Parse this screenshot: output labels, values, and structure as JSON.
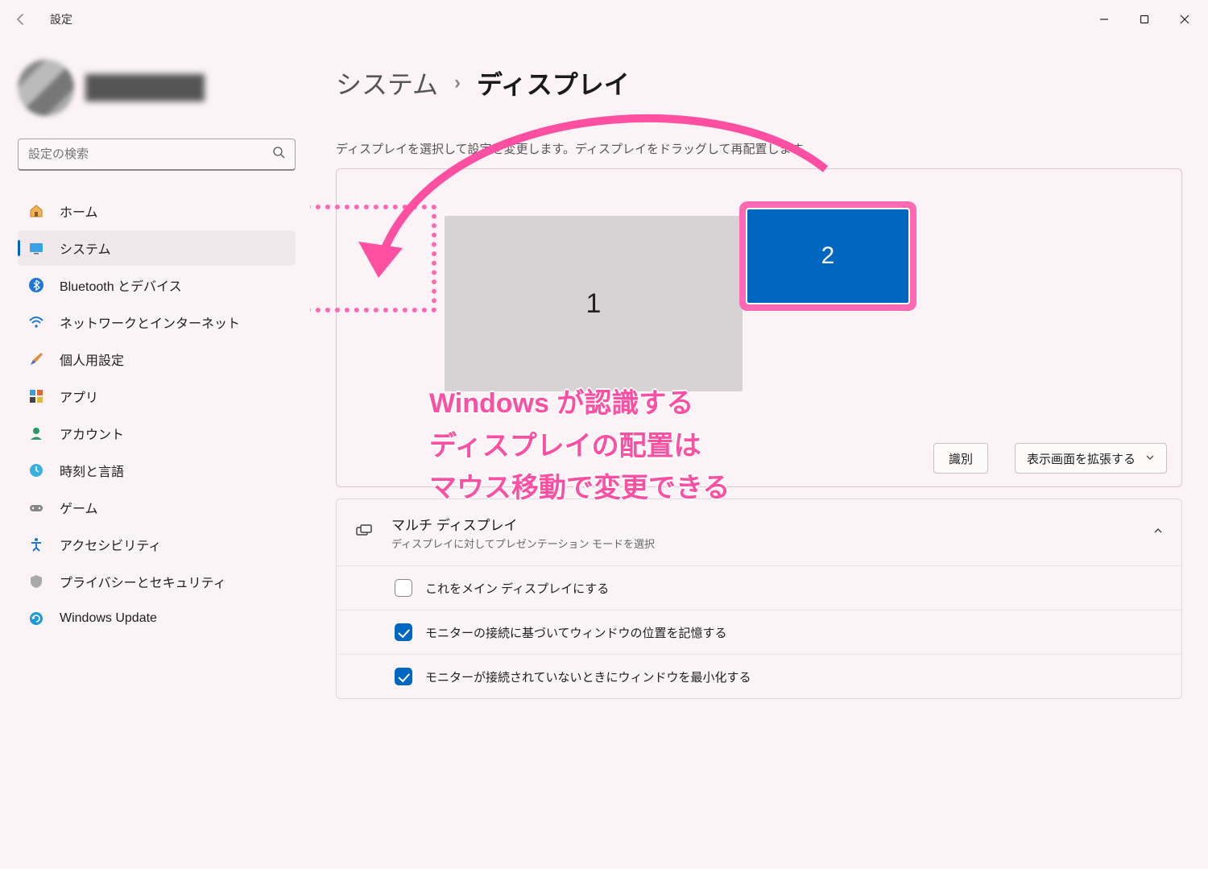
{
  "window": {
    "title": "設定"
  },
  "search": {
    "placeholder": "設定の検索"
  },
  "nav": {
    "home": "ホーム",
    "system": "システム",
    "bluetooth": "Bluetooth とデバイス",
    "network": "ネットワークとインターネット",
    "personal": "個人用設定",
    "apps": "アプリ",
    "accounts": "アカウント",
    "time": "時刻と言語",
    "gaming": "ゲーム",
    "accessibility": "アクセシビリティ",
    "privacy": "プライバシーとセキュリティ",
    "update": "Windows Update"
  },
  "breadcrumb": {
    "parent": "システム",
    "current": "ディスプレイ"
  },
  "display": {
    "instruction": "ディスプレイを選択して設定を変更します。ディスプレイをドラッグして再配置します。",
    "monitor1": "1",
    "monitor2": "2",
    "identify": "識別",
    "extend": "表示画面を拡張する"
  },
  "multi": {
    "title": "マルチ ディスプレイ",
    "subtitle": "ディスプレイに対してプレゼンテーション モードを選択",
    "opt_main": "これをメイン ディスプレイにする",
    "opt_remember": "モニターの接続に基づいてウィンドウの位置を記憶する",
    "opt_minimize": "モニターが接続されていないときにウィンドウを最小化する"
  },
  "annotation": {
    "text": "Windows が認識する\nディスプレイの配置は\nマウス移動で変更できる"
  },
  "colors": {
    "accent": "#0067c0",
    "pink": "#FF69B4"
  }
}
